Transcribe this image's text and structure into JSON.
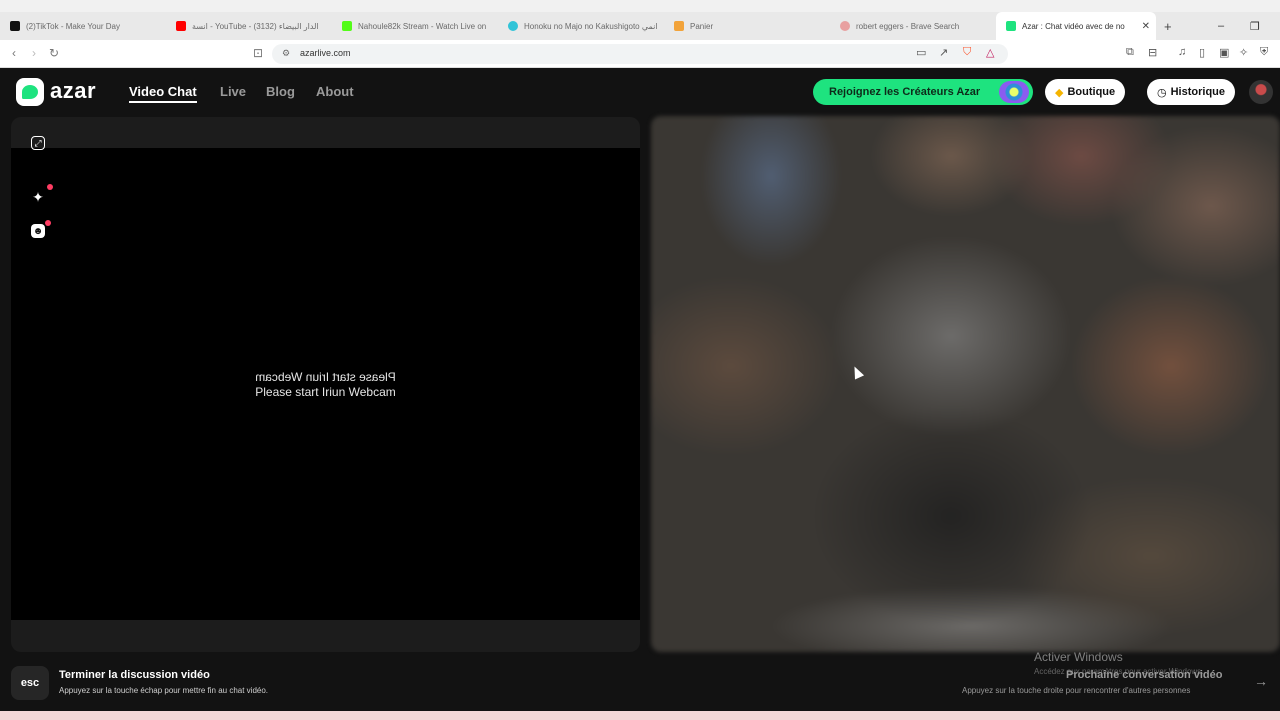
{
  "browser": {
    "tabs": [
      {
        "label": "(2)TikTok - Make Your Day",
        "color": "#111111"
      },
      {
        "label": "انسة - YouTube - (3132) الدار البيضاء",
        "color": "#ff0000"
      },
      {
        "label": "Nahoule82k Stream - Watch Live on",
        "color": "#53fc18"
      },
      {
        "label": "Honoku no Majo no Kakushigoto انمي",
        "color": "#31c4d8"
      },
      {
        "label": "Panier",
        "color": "#f2a33a"
      },
      {
        "label": "robert eggers - Brave Search",
        "color": "#e8a0a0"
      },
      {
        "label": "Azar : Chat vidéo avec de no",
        "color": "#1ee37f",
        "active": true
      }
    ],
    "new_tab": "+",
    "window_controls": {
      "minimize": "–",
      "restore": "❐"
    },
    "url": "azarlive.com",
    "accent": "#1ee37f"
  },
  "site": {
    "logo": "azar",
    "nav": [
      {
        "label": "Video Chat",
        "active": true
      },
      {
        "label": "Live"
      },
      {
        "label": "Blog"
      },
      {
        "label": "About"
      }
    ],
    "creators_button": "Rejoignez les Créateurs Azar",
    "shop_button": "Boutique",
    "history_button": "Historique"
  },
  "self_video": {
    "message": "Please start Iriun Webcam",
    "icons": [
      "expand-icon",
      "sparkle-icon",
      "sticker-icon"
    ]
  },
  "footer": {
    "esc_key": "esc",
    "end_title": "Terminer la discussion vidéo",
    "end_subtitle": "Appuyez sur la touche échap pour mettre fin au chat vidéo.",
    "next_title": "Prochaine conversation vidéo",
    "next_subtitle": "Appuyez sur la touche droite pour rencontrer d'autres personnes",
    "next_arrow": "→"
  },
  "watermark": {
    "title": "Activer Windows",
    "subtitle": "Accédez aux paramètres pour activer Windows."
  }
}
